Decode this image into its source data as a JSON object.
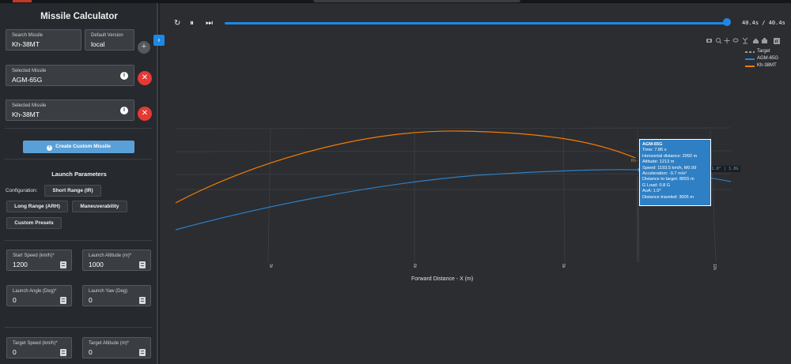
{
  "sidebar": {
    "title": "Missile Calculator",
    "search": {
      "label": "Search Missile",
      "value": "Kh-38MT"
    },
    "version": {
      "label": "Default Version",
      "value": "local"
    },
    "add_symbol": "+",
    "selected": [
      {
        "label": "Selected Missile",
        "value": "AGM-65G",
        "info": "i",
        "remove": "✕"
      },
      {
        "label": "Selected Missile",
        "value": "Kh-38MT",
        "info": "i",
        "remove": "✕"
      }
    ],
    "create_button": "Create Custom Missile",
    "create_icon": "+",
    "collapse_icon": "‹",
    "launch_title": "Launch Parameters",
    "configuration_label": "Configuration:",
    "presets": [
      "Short Range (IR)",
      "Long Range (ARH)",
      "Maneuverability",
      "Custom Presets"
    ],
    "params": [
      {
        "label": "Start Speed (km/h)*",
        "value": "1200"
      },
      {
        "label": "Launch Altitude (m)*",
        "value": "1000"
      },
      {
        "label": "Launch Angle (Deg)*",
        "value": "0"
      },
      {
        "label": "Launch Yaw (Deg)",
        "value": "0"
      },
      {
        "label": "Target Speed (km/h)*",
        "value": "0"
      },
      {
        "label": "Target Altitude (m)*",
        "value": "0"
      }
    ]
  },
  "player": {
    "replay_icon": "↻",
    "pause_icon": "⏸",
    "skip_icon": "⏭",
    "progress": 1.0,
    "time_text": "40.4s / 40.4s"
  },
  "modebar": [
    "camera-icon",
    "zoom-icon",
    "pan-icon",
    "lasso-icon",
    "autoscale-icon",
    "home-icon",
    "spike-icon",
    "plotly-logo-icon"
  ],
  "legend": [
    {
      "name": "Target",
      "color": "#9e9e9e",
      "dash": true
    },
    {
      "name": "AGM-65G",
      "color": "#1e88e5",
      "dash": false
    },
    {
      "name": "Kh-38MT",
      "color": "#f57c00",
      "dash": false
    }
  ],
  "chart_data": {
    "type": "line",
    "xlabel": "Forward Distance - X (m)",
    "x_ticks": [
      "3k",
      "6k",
      "9k",
      "12k"
    ],
    "series": [
      {
        "name": "AGM-65G",
        "color": "#2f7fc4"
      },
      {
        "name": "Kh-38MT",
        "color": "#f57c00"
      }
    ],
    "hover_labels": {
      "kh": "Kh-38MT | 1.2° | 2.1G",
      "agm": "AGM-65G | 1.0° | 1.0G"
    },
    "tooltip": {
      "title": "AGM-65G",
      "lines": [
        "Time: 7.86 s",
        "Horizontal distance: 2992 m",
        "Altitude: 1213 m",
        "Speed: 1193.5 km/h, M0.99",
        "Acceleration: -9.7 m/s²",
        "Distance to target: 8055 m",
        "G Load: 0.8 G",
        "AoA: 1.0°",
        "Distance traveled: 3005 m"
      ]
    }
  }
}
